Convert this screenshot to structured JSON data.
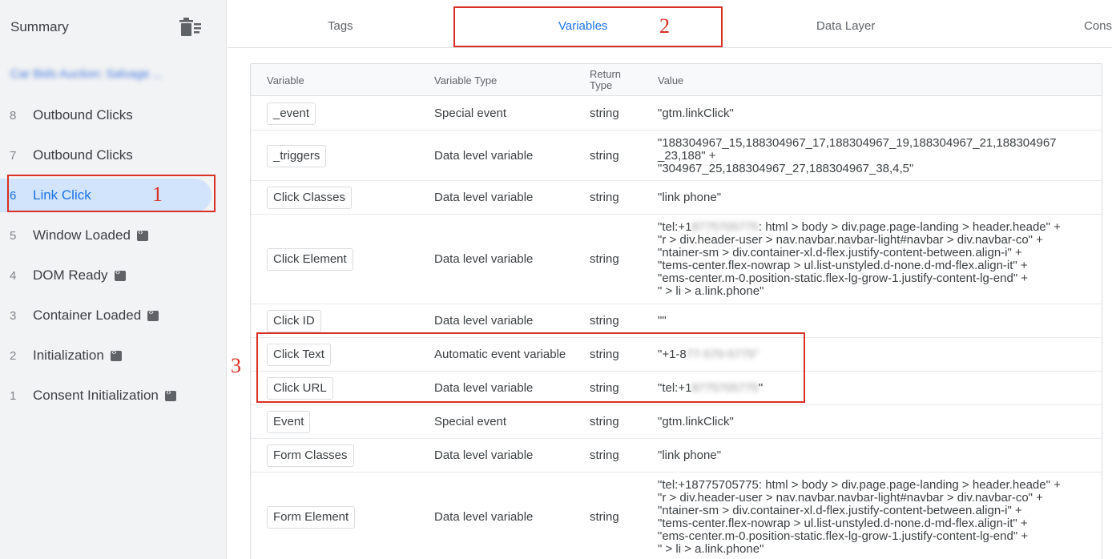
{
  "sidebar": {
    "title": "Summary",
    "site": "Car Bids Auction: Salvage ...",
    "items": [
      {
        "num": "8",
        "label": "Outbound Clicks",
        "badge": false
      },
      {
        "num": "7",
        "label": "Outbound Clicks",
        "badge": false
      },
      {
        "num": "6",
        "label": "Link Click",
        "badge": false,
        "active": true
      },
      {
        "num": "5",
        "label": "Window Loaded",
        "badge": true
      },
      {
        "num": "4",
        "label": "DOM Ready",
        "badge": true
      },
      {
        "num": "3",
        "label": "Container Loaded",
        "badge": true
      },
      {
        "num": "2",
        "label": "Initialization",
        "badge": true
      },
      {
        "num": "1",
        "label": "Consent Initialization",
        "badge": true
      }
    ]
  },
  "tabs": [
    "Tags",
    "Variables",
    "Data Layer",
    "Cons"
  ],
  "table": {
    "headers": {
      "variable": "Variable",
      "type": "Variable Type",
      "return1": "Return",
      "return2": "Type",
      "value": "Value"
    },
    "rows": [
      {
        "name": "_event",
        "type": "Special event",
        "ret": "string",
        "value": "\"gtm.linkClick\""
      },
      {
        "name": "_triggers",
        "type": "Data level variable",
        "ret": "string",
        "value": "\"188304967_15,188304967_17,188304967_19,188304967_21,188304967\n_23,188\" +\n\"304967_25,188304967_27,188304967_38,4,5\""
      },
      {
        "name": "Click Classes",
        "type": "Data level variable",
        "ret": "string",
        "value": "\"link phone\""
      },
      {
        "name": "Click Element",
        "type": "Data level variable",
        "ret": "string",
        "value_prefix": "\"tel:+1",
        "value_blur": "8775705775",
        "value": ": html > body > div.page.page-landing > header.heade\" +\n\"r > div.header-user > nav.navbar.navbar-light#navbar > div.navbar-co\" +\n\"ntainer-sm > div.container-xl.d-flex.justify-content-between.align-i\" +\n\"tems-center.flex-nowrap > ul.list-unstyled.d-none.d-md-flex.align-it\" +\n\"ems-center.m-0.position-static.flex-lg-grow-1.justify-content-lg-end\" +\n\" > li > a.link.phone\""
      },
      {
        "name": "Click ID",
        "type": "Data level variable",
        "ret": "string",
        "value": "\"\""
      },
      {
        "name": "Click Text",
        "type": "Automatic event variable",
        "ret": "string",
        "value_prefix": "\"+1-8",
        "value_blur": "77-570-5775\"",
        "value": ""
      },
      {
        "name": "Click URL",
        "type": "Data level variable",
        "ret": "string",
        "value_prefix": "\"tel:+1",
        "value_blur": "8775705775",
        "value": "\""
      },
      {
        "name": "Event",
        "type": "Special event",
        "ret": "string",
        "value": "\"gtm.linkClick\""
      },
      {
        "name": "Form Classes",
        "type": "Data level variable",
        "ret": "string",
        "value": "\"link phone\""
      },
      {
        "name": "Form Element",
        "type": "Data level variable",
        "ret": "string",
        "value": "\"tel:+18775705775: html > body > div.page.page-landing > header.heade\" +\n\"r > div.header-user > nav.navbar.navbar-light#navbar > div.navbar-co\" +\n\"ntainer-sm > div.container-xl.d-flex.justify-content-between.align-i\" +\n\"tems-center.flex-nowrap > ul.list-unstyled.d-none.d-md-flex.align-it\" +\n\"ems-center.m-0.position-static.flex-lg-grow-1.justify-content-lg-end\" +\n\" > li > a.link.phone\""
      }
    ]
  },
  "annotations": [
    "1",
    "2",
    "3"
  ]
}
